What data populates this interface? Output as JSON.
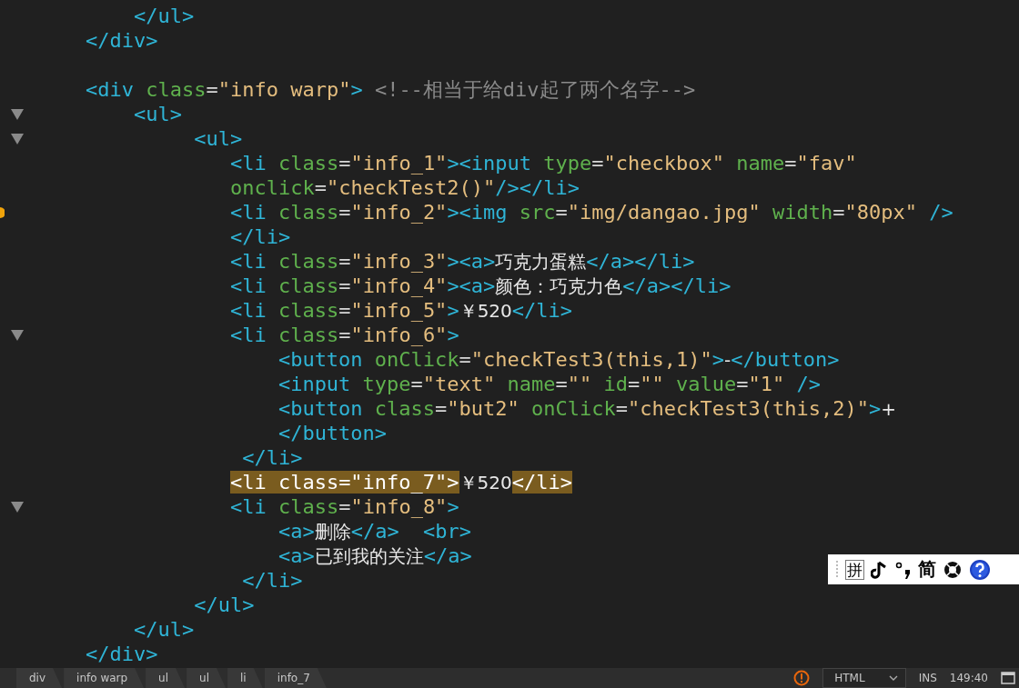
{
  "editor": {
    "lines": [
      {
        "fold": false,
        "marked": false,
        "tokens": [
          {
            "kind": "tag",
            "text": "        </ul>"
          }
        ]
      },
      {
        "fold": false,
        "marked": false,
        "tokens": [
          {
            "kind": "tag",
            "text": "    </div>"
          }
        ]
      },
      {
        "fold": false,
        "marked": false
      },
      {
        "fold": false,
        "marked": false,
        "tokens": [
          {
            "kind": "tag",
            "text": "    <div"
          },
          {
            "kind": "attr",
            "text": " class"
          },
          {
            "kind": "punct",
            "text": "="
          },
          {
            "kind": "value",
            "text": "\"info warp\""
          },
          {
            "kind": "tag",
            "text": ">"
          },
          {
            "kind": "comment",
            "text": " <!--相当于给div起了两个名字-->"
          }
        ]
      },
      {
        "fold": true,
        "marked": false,
        "tokens": [
          {
            "kind": "tag",
            "text": "        <ul>"
          }
        ]
      },
      {
        "fold": true,
        "marked": false,
        "tokens": [
          {
            "kind": "tag",
            "text": "             <ul>"
          }
        ]
      },
      {
        "fold": false,
        "marked": false,
        "tokens": [
          {
            "kind": "tag",
            "text": "                <li"
          },
          {
            "kind": "attr",
            "text": " class"
          },
          {
            "kind": "punct",
            "text": "="
          },
          {
            "kind": "value",
            "text": "\"info_1\""
          },
          {
            "kind": "tag",
            "text": "><input"
          },
          {
            "kind": "attr",
            "text": " type"
          },
          {
            "kind": "punct",
            "text": "="
          },
          {
            "kind": "value",
            "text": "\"checkbox\""
          },
          {
            "kind": "attr",
            "text": " name"
          },
          {
            "kind": "punct",
            "text": "="
          },
          {
            "kind": "value",
            "text": "\"fav\""
          }
        ]
      },
      {
        "fold": false,
        "marked": false,
        "tokens": [
          {
            "kind": "attr",
            "text": "                onclick"
          },
          {
            "kind": "punct",
            "text": "="
          },
          {
            "kind": "value",
            "text": "\"checkTest2()\""
          },
          {
            "kind": "tag",
            "text": "/></li>"
          }
        ]
      },
      {
        "fold": false,
        "marked": true,
        "tokens": [
          {
            "kind": "tag",
            "text": "                <li"
          },
          {
            "kind": "attr",
            "text": " class"
          },
          {
            "kind": "punct",
            "text": "="
          },
          {
            "kind": "value",
            "text": "\"info_2\""
          },
          {
            "kind": "tag",
            "text": "><img"
          },
          {
            "kind": "attr",
            "text": " src"
          },
          {
            "kind": "punct",
            "text": "="
          },
          {
            "kind": "value",
            "text": "\"img/dangao.jpg\""
          },
          {
            "kind": "attr",
            "text": " width"
          },
          {
            "kind": "punct",
            "text": "="
          },
          {
            "kind": "value",
            "text": "\"80px\""
          },
          {
            "kind": "tag",
            "text": " />"
          }
        ]
      },
      {
        "fold": false,
        "marked": false,
        "tokens": [
          {
            "kind": "tag",
            "text": "                </li>"
          }
        ]
      },
      {
        "fold": false,
        "marked": false,
        "tokens": [
          {
            "kind": "tag",
            "text": "                <li"
          },
          {
            "kind": "attr",
            "text": " class"
          },
          {
            "kind": "punct",
            "text": "="
          },
          {
            "kind": "value",
            "text": "\"info_3\""
          },
          {
            "kind": "tag",
            "text": "><a>"
          },
          {
            "kind": "text",
            "text": "巧克力蛋糕"
          },
          {
            "kind": "tag",
            "text": "</a></li>"
          }
        ]
      },
      {
        "fold": false,
        "marked": false,
        "tokens": [
          {
            "kind": "tag",
            "text": "                <li"
          },
          {
            "kind": "attr",
            "text": " class"
          },
          {
            "kind": "punct",
            "text": "="
          },
          {
            "kind": "value",
            "text": "\"info_4\""
          },
          {
            "kind": "tag",
            "text": "><a>"
          },
          {
            "kind": "text",
            "text": "颜色：巧克力色"
          },
          {
            "kind": "tag",
            "text": "</a></li>"
          }
        ]
      },
      {
        "fold": false,
        "marked": false,
        "tokens": [
          {
            "kind": "tag",
            "text": "                <li"
          },
          {
            "kind": "attr",
            "text": " class"
          },
          {
            "kind": "punct",
            "text": "="
          },
          {
            "kind": "value",
            "text": "\"info_5\""
          },
          {
            "kind": "tag",
            "text": ">"
          },
          {
            "kind": "text",
            "text": "￥520"
          },
          {
            "kind": "tag",
            "text": "</li>"
          }
        ]
      },
      {
        "fold": true,
        "marked": false,
        "tokens": [
          {
            "kind": "tag",
            "text": "                <li"
          },
          {
            "kind": "attr",
            "text": " class"
          },
          {
            "kind": "punct",
            "text": "="
          },
          {
            "kind": "value",
            "text": "\"info_6\""
          },
          {
            "kind": "tag",
            "text": ">"
          }
        ]
      },
      {
        "fold": false,
        "marked": false,
        "tokens": [
          {
            "kind": "tag",
            "text": "                    <button"
          },
          {
            "kind": "attr",
            "text": " onClick"
          },
          {
            "kind": "punct",
            "text": "="
          },
          {
            "kind": "value",
            "text": "\"checkTest3(this,1)\""
          },
          {
            "kind": "tag",
            "text": ">"
          },
          {
            "kind": "text",
            "text": "-"
          },
          {
            "kind": "tag",
            "text": "</button>"
          }
        ]
      },
      {
        "fold": false,
        "marked": false,
        "tokens": [
          {
            "kind": "tag",
            "text": "                    <input"
          },
          {
            "kind": "attr",
            "text": " type"
          },
          {
            "kind": "punct",
            "text": "="
          },
          {
            "kind": "value",
            "text": "\"text\""
          },
          {
            "kind": "attr",
            "text": " name"
          },
          {
            "kind": "punct",
            "text": "="
          },
          {
            "kind": "value",
            "text": "\"\""
          },
          {
            "kind": "attr",
            "text": " id"
          },
          {
            "kind": "punct",
            "text": "="
          },
          {
            "kind": "value",
            "text": "\"\""
          },
          {
            "kind": "attr",
            "text": " value"
          },
          {
            "kind": "punct",
            "text": "="
          },
          {
            "kind": "value",
            "text": "\"1\""
          },
          {
            "kind": "tag",
            "text": " />"
          }
        ]
      },
      {
        "fold": false,
        "marked": false,
        "tokens": [
          {
            "kind": "tag",
            "text": "                    <button"
          },
          {
            "kind": "attr",
            "text": " class"
          },
          {
            "kind": "punct",
            "text": "="
          },
          {
            "kind": "value",
            "text": "\"but2\""
          },
          {
            "kind": "attr",
            "text": " onClick"
          },
          {
            "kind": "punct",
            "text": "="
          },
          {
            "kind": "value",
            "text": "\"checkTest3(this,2)\""
          },
          {
            "kind": "tag",
            "text": ">"
          },
          {
            "kind": "text",
            "text": "+"
          }
        ]
      },
      {
        "fold": false,
        "marked": false,
        "tokens": [
          {
            "kind": "tag",
            "text": "                    </button>"
          }
        ]
      },
      {
        "fold": false,
        "marked": false,
        "tokens": [
          {
            "kind": "tag",
            "text": "                 </li>"
          }
        ]
      },
      {
        "fold": false,
        "marked": false,
        "tokens": [
          {
            "kind": "match",
            "text": "                <li class=\"info_7\">"
          },
          {
            "kind": "text",
            "text": "￥520"
          },
          {
            "kind": "match",
            "text": "</li>"
          }
        ]
      },
      {
        "fold": true,
        "marked": false,
        "tokens": [
          {
            "kind": "tag",
            "text": "                <li"
          },
          {
            "kind": "attr",
            "text": " class"
          },
          {
            "kind": "punct",
            "text": "="
          },
          {
            "kind": "value",
            "text": "\"info_8\""
          },
          {
            "kind": "tag",
            "text": ">"
          }
        ]
      },
      {
        "fold": false,
        "marked": false,
        "tokens": [
          {
            "kind": "tag",
            "text": "                    <a>"
          },
          {
            "kind": "text",
            "text": "删除"
          },
          {
            "kind": "tag",
            "text": "</a>  <br>"
          }
        ]
      },
      {
        "fold": false,
        "marked": false,
        "tokens": [
          {
            "kind": "tag",
            "text": "                    <a>"
          },
          {
            "kind": "text",
            "text": "已到我的关注"
          },
          {
            "kind": "tag",
            "text": "</a>"
          }
        ]
      },
      {
        "fold": false,
        "marked": false,
        "tokens": [
          {
            "kind": "tag",
            "text": "                 </li>"
          }
        ]
      },
      {
        "fold": false,
        "marked": false,
        "tokens": [
          {
            "kind": "tag",
            "text": "             </ul>"
          }
        ]
      },
      {
        "fold": false,
        "marked": false,
        "tokens": [
          {
            "kind": "tag",
            "text": "        </ul>"
          }
        ]
      },
      {
        "fold": false,
        "marked": false,
        "tokens": [
          {
            "kind": "tag",
            "text": "    </div>"
          }
        ]
      }
    ]
  },
  "ime_toolbar": {
    "mode": "拼",
    "script": "简"
  },
  "status_bar": {
    "breadcrumbs": [
      "div",
      "info warp",
      "ul",
      "ul",
      "li",
      "info_7"
    ],
    "syntax": "HTML",
    "insert_mode": "INS",
    "cursor_position": "149:40"
  }
}
